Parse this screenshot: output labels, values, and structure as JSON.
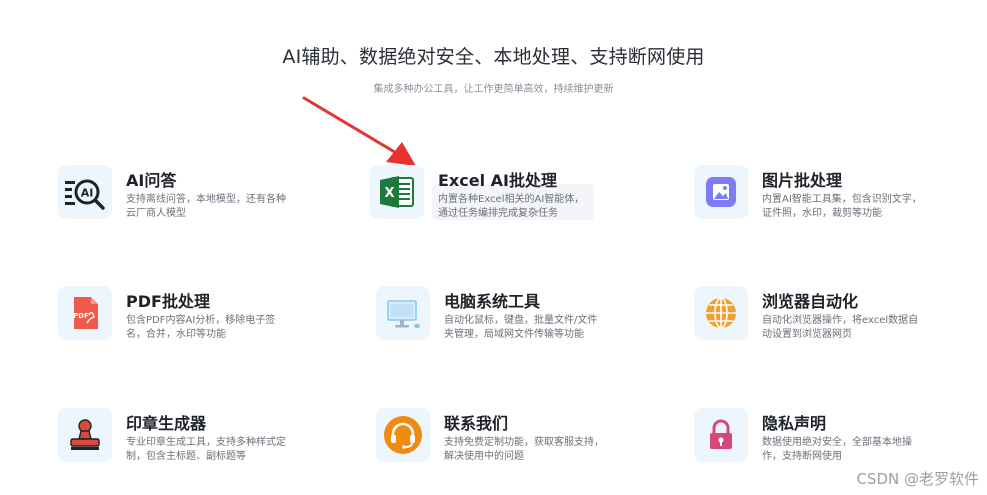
{
  "hero": {
    "headline": "AI辅助、数据绝对安全、本地处理、支持断网使用",
    "subline": "集成多种办公工具，让工作更简单高效，持续维护更新"
  },
  "features": [
    {
      "title": "AI问答",
      "desc": "支持离线问答，本地模型，还有各种云厂商人模型",
      "icon": "ai-search-icon"
    },
    {
      "title": "Excel AI批处理",
      "desc": "内置各种Excel相关的AI智能体，通过任务编排完成复杂任务",
      "icon": "excel-icon"
    },
    {
      "title": "图片批处理",
      "desc": "内置AI智能工具集，包含识别文字，证件照，水印，裁剪等功能",
      "icon": "image-icon"
    },
    {
      "title": "PDF批处理",
      "desc": "包含PDF内容AI分析，移除电子签名，合并，水印等功能",
      "icon": "pdf-icon"
    },
    {
      "title": "电脑系统工具",
      "desc": "自动化鼠标，键盘，批量文件/文件夹管理，局域网文件传输等功能",
      "icon": "monitor-icon"
    },
    {
      "title": "浏览器自动化",
      "desc": "自动化浏览器操作，将excel数据自动设置到浏览器网页",
      "icon": "globe-icon"
    },
    {
      "title": "印章生成器",
      "desc": "专业印章生成工具，支持多种样式定制，包含主标题、副标题等",
      "icon": "stamp-icon"
    },
    {
      "title": "联系我们",
      "desc": "支持免费定制功能，获取客服支持，解决使用中的问题",
      "icon": "headset-icon"
    },
    {
      "title": "隐私声明",
      "desc": "数据使用绝对安全，全部基本地操作，支持断网使用",
      "icon": "lock-icon"
    }
  ],
  "watermark": "CSDN @老罗软件",
  "colors": {
    "arrow": "#e8322f",
    "excel_green": "#1d7a3c",
    "image_purple": "#7f7cf3",
    "pdf_red": "#ef5a4c",
    "globe_orange": "#f0a030",
    "stamp_red": "#d94a3a",
    "headset_orange": "#f08a10",
    "lock_pink": "#d6487a"
  }
}
